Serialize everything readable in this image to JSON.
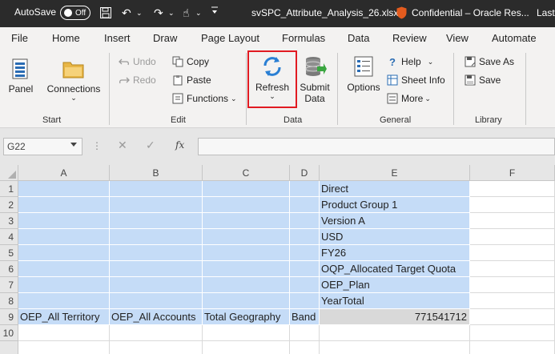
{
  "titlebar": {
    "autosave_label": "AutoSave",
    "toggle_state": "Off",
    "filename": "svSPC_Attribute_Analysis_26.xlsx",
    "sensitivity": "Confidential – Oracle Res...",
    "overflow_text": "Last"
  },
  "menu": {
    "tabs": [
      "File",
      "Home",
      "Insert",
      "Draw",
      "Page Layout",
      "Formulas",
      "Data",
      "Review",
      "View",
      "Automate"
    ]
  },
  "ribbon": {
    "start": {
      "panel_label": "Panel",
      "connections_label": "Connections",
      "group_label": "Start"
    },
    "edit": {
      "undo_label": "Undo",
      "redo_label": "Redo",
      "copy_label": "Copy",
      "paste_label": "Paste",
      "functions_label": "Functions",
      "group_label": "Edit"
    },
    "data": {
      "refresh_label": "Refresh",
      "submit_label_1": "Submit",
      "submit_label_2": "Data",
      "group_label": "Data"
    },
    "general": {
      "options_label": "Options",
      "help_label": "Help",
      "sheet_info_label": "Sheet Info",
      "more_label": "More",
      "group_label": "General"
    },
    "library": {
      "save_as_label": "Save As",
      "save_label": "Save",
      "group_label": "Library"
    }
  },
  "formula_bar": {
    "name_box": "G22",
    "fx_label": "fx",
    "value": ""
  },
  "sheet": {
    "columns": [
      "A",
      "B",
      "C",
      "D",
      "E",
      "F"
    ],
    "rows": [
      "1",
      "2",
      "3",
      "4",
      "5",
      "6",
      "7",
      "8",
      "9",
      "10"
    ],
    "e_column": [
      "Direct",
      "Product Group 1",
      "Version A",
      "USD",
      "FY26",
      "OQP_Allocated Target Quota",
      "OEP_Plan",
      "YearTotal"
    ],
    "row9": {
      "a": "OEP_All Territory",
      "b": "OEP_All Accounts",
      "c": "Total Geography",
      "d": "Band",
      "e": "771541712"
    }
  },
  "colors": {
    "titlebar_bg": "#2b2b2b",
    "ribbon_bg": "#f3f2f1",
    "selection_blue": "#c5dcf7",
    "data_gray": "#d9d9d9",
    "highlight_red": "#e11b22"
  }
}
